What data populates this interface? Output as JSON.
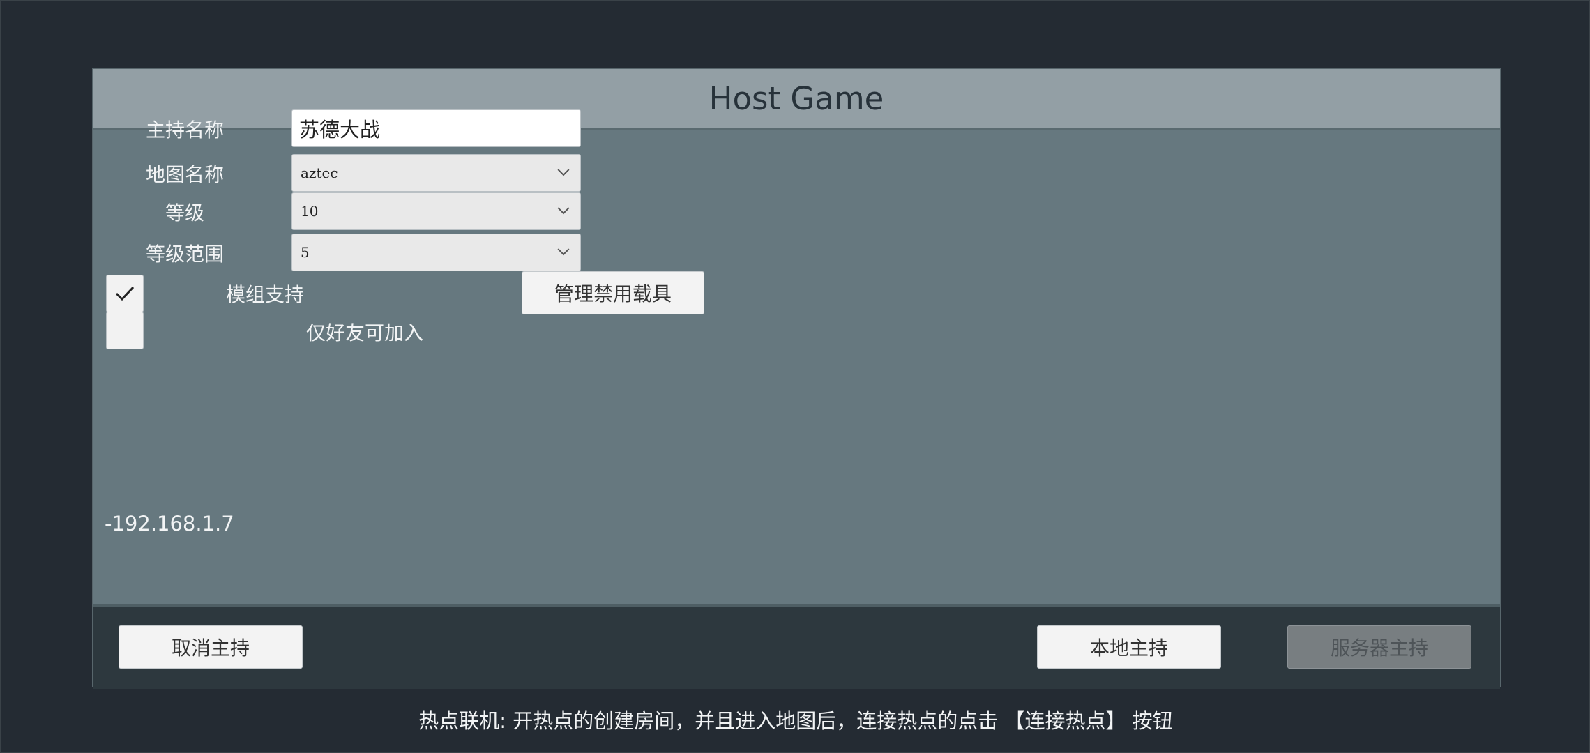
{
  "dialog": {
    "title": "Host Game"
  },
  "form": {
    "host_name_label": "主持名称",
    "host_name_value": "苏德大战",
    "map_label": "地图名称",
    "map_value": "aztec",
    "level_label": "等级",
    "level_value": "10",
    "level_range_label": "等级范围",
    "level_range_value": "5",
    "mod_support_label": "模组支持",
    "mod_support_checked": true,
    "friends_only_label": "仅好友可加入",
    "friends_only_checked": false,
    "manage_banned_vehicles_label": "管理禁用载具",
    "ip_address": "-192.168.1.7"
  },
  "footer": {
    "cancel_label": "取消主持",
    "local_host_label": "本地主持",
    "server_host_label": "服务器主持"
  },
  "hint": "热点联机: 开热点的创建房间，并且进入地图后，连接热点的点击 【连接热点】 按钮",
  "icons": {
    "checkmark": "check-icon",
    "dropdown": "chevron-down-icon"
  }
}
